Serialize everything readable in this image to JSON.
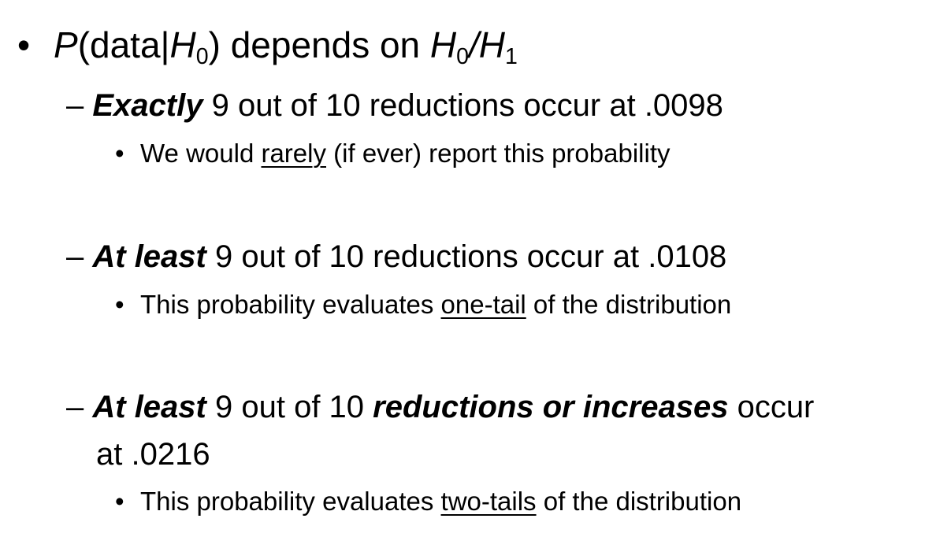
{
  "bullet_char": "•",
  "dash_char": "–",
  "heading": {
    "p": "P",
    "paren_open": "(data",
    "bar": "|",
    "h0_a": "H",
    "h0_a_sub": "0",
    "paren_close": ") depends on ",
    "h0_b": "H",
    "h0_b_sub": "0",
    "slash": "/",
    "h1": "H",
    "h1_sub": "1"
  },
  "items": [
    {
      "emphasis": "Exactly",
      "text": " 9 out of 10 reductions occur at .0098",
      "note_before": "We would ",
      "note_underlined": "rarely",
      "note_after": " (if ever) report this probability"
    },
    {
      "emphasis": "At least",
      "text": " 9 out of 10 reductions occur at .0108",
      "note_before": "This probability evaluates ",
      "note_underlined": "one-tail",
      "note_after": " of the distribution"
    },
    {
      "emphasis": "At least",
      "text_mid": " 9 out of 10 ",
      "emphasis2": "reductions or increases",
      "text_end": " occur",
      "text_line2": "at .0216",
      "note_before": "This probability evaluates ",
      "note_underlined": "two-tails",
      "note_after": " of the distribution"
    }
  ]
}
